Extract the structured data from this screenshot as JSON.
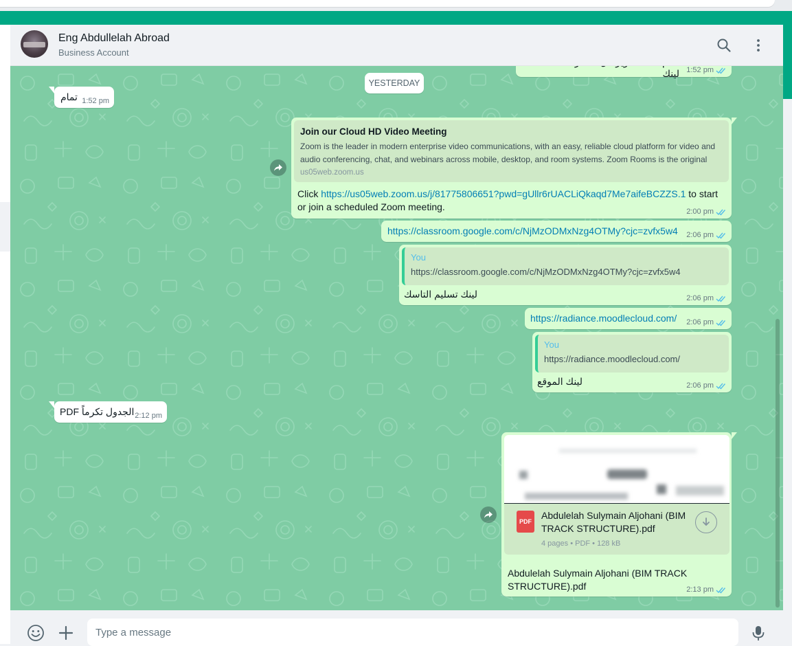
{
  "header": {
    "contact_name": "Eng Abdullelah Abroad",
    "contact_subtitle": "Business Account"
  },
  "date_separator": "YESTERDAY",
  "messages": {
    "m0": {
      "text": "zoom تمام نحتفات ويرسل لحضرتك لينك",
      "time": "1:52 pm"
    },
    "m1": {
      "text": "تمام",
      "time": "1:52 pm"
    },
    "m2": {
      "preview_title": "Join our Cloud HD Video Meeting",
      "preview_desc": "Zoom is the leader in modern enterprise video communications, with an easy, reliable cloud platform for video and audio conferencing, chat, and webinars across mobile, desktop, and room systems. Zoom Rooms is the original",
      "preview_domain": "us05web.zoom.us",
      "text_before": "Click ",
      "link": "https://us05web.zoom.us/j/81775806651?pwd=gUllr6rUACLiQkaqd7Me7aifeBCZZS.1",
      "text_after": " to start or join a scheduled Zoom meeting.",
      "time": "2:00 pm"
    },
    "m3": {
      "link": "https://classroom.google.com/c/NjMzODMxNzg4OTMy?cjc=zvfx5w4",
      "time": "2:06 pm"
    },
    "m4": {
      "quote_name": "You",
      "quote_text": "https://classroom.google.com/c/NjMzODMxNzg4OTMy?cjc=zvfx5w4",
      "text": "لينك تسليم التاسك",
      "time": "2:06 pm"
    },
    "m5": {
      "link": "https://radiance.moodlecloud.com/",
      "time": "2:06 pm"
    },
    "m6": {
      "quote_name": "You",
      "quote_text": "https://radiance.moodlecloud.com/",
      "text": "لينك الموقع",
      "time": "2:06 pm"
    },
    "m7": {
      "text": "الجدول تكرماً PDF",
      "time": "2:12 pm"
    },
    "m8": {
      "pdf_badge": "PDF",
      "doc_name": "Abdulelah Sulymain Aljohani (BIM TRACK STRUCTURE).pdf",
      "doc_meta": "4 pages • PDF • 128 kB",
      "caption": "Abdulelah Sulymain Aljohani (BIM TRACK STRUCTURE).pdf",
      "time": "2:13 pm"
    }
  },
  "composer": {
    "placeholder": "Type a message"
  },
  "colors": {
    "accent": "#00a884",
    "wallpaper": "#7fcca4",
    "outgoing_bubble": "#d9fdd3",
    "incoming_bubble": "#ffffff",
    "link": "#027eb5",
    "read_ticks": "#53bdeb"
  },
  "icons": {
    "header": [
      "search-icon",
      "menu-dots-icon"
    ],
    "composer": [
      "emoji-icon",
      "plus-icon",
      "microphone-icon"
    ],
    "bubbles": [
      "double-check-icon",
      "forward-icon",
      "pdf-icon",
      "download-icon"
    ]
  }
}
